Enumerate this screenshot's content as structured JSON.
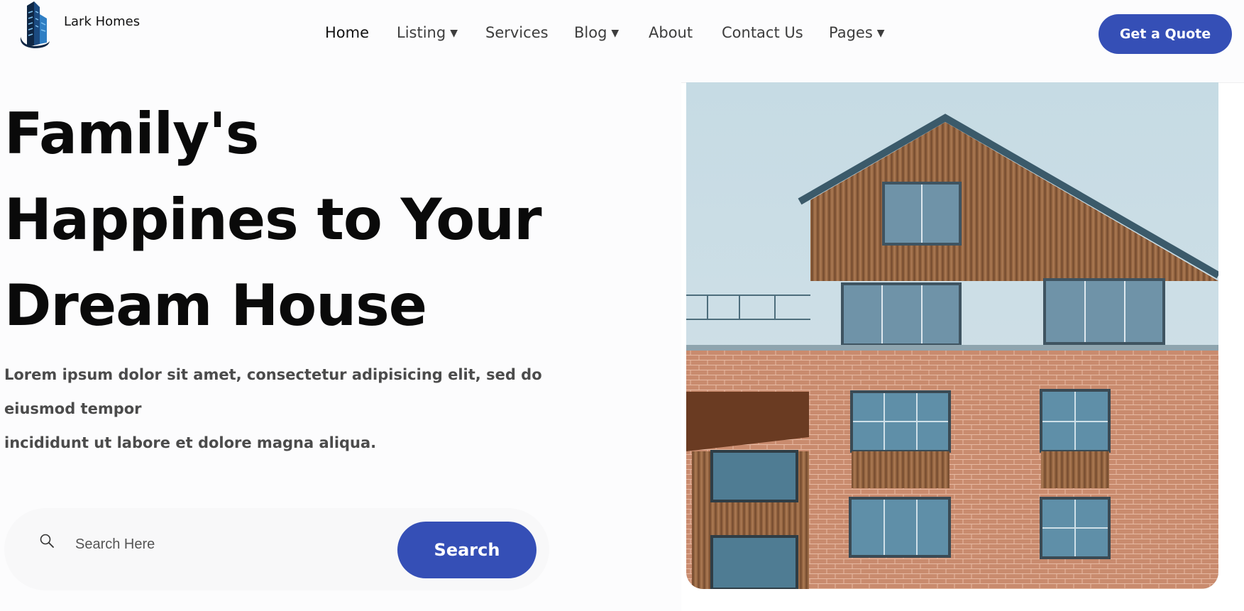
{
  "header": {
    "brand": "Lark Homes",
    "nav": [
      {
        "label": "Home",
        "active": true,
        "dropdown": false
      },
      {
        "label": "Listing",
        "active": false,
        "dropdown": true
      },
      {
        "label": "Services",
        "active": false,
        "dropdown": false
      },
      {
        "label": "Blog",
        "active": false,
        "dropdown": true
      },
      {
        "label": "About",
        "active": false,
        "dropdown": false
      },
      {
        "label": "Contact Us",
        "active": false,
        "dropdown": false
      },
      {
        "label": "Pages",
        "active": false,
        "dropdown": true
      }
    ],
    "cta_label": "Get a Quote"
  },
  "hero": {
    "title_lines": [
      "Family's",
      "Happines to Your",
      "Dream House"
    ],
    "description_lines": [
      "Lorem ipsum dolor sit amet, consectetur adipisicing elit, sed do",
      "eiusmod tempor",
      "incididunt ut labore et dolore magna aliqua."
    ],
    "search": {
      "placeholder": "Search Here",
      "button_label": "Search",
      "icon": "search-icon"
    }
  },
  "colors": {
    "accent": "#354fb6",
    "heading": "#0a0a0a",
    "body_text": "#4b4b4b"
  },
  "icons": {
    "logo": "building-logo-icon",
    "dropdown": "caret-down-icon"
  }
}
